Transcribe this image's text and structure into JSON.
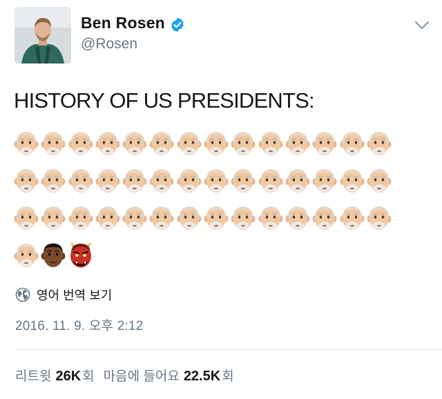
{
  "author": {
    "name": "Ben Rosen",
    "handle": "@Rosen",
    "verified": true
  },
  "tweet": {
    "text": "HISTORY OF US PRESIDENTS:",
    "emoji_rows": [
      [
        "older-man",
        "older-man",
        "older-man",
        "older-man",
        "older-man",
        "older-man",
        "older-man",
        "older-man",
        "older-man",
        "older-man",
        "older-man",
        "older-man",
        "older-man",
        "older-man"
      ],
      [
        "older-man",
        "older-man",
        "older-man",
        "older-man",
        "older-man",
        "older-man",
        "older-man",
        "older-man",
        "older-man",
        "older-man",
        "older-man",
        "older-man",
        "older-man",
        "older-man"
      ],
      [
        "older-man",
        "older-man",
        "older-man",
        "older-man",
        "older-man",
        "older-man",
        "older-man",
        "older-man",
        "older-man",
        "older-man",
        "older-man",
        "older-man",
        "older-man",
        "older-man"
      ],
      [
        "older-man",
        "man-dark-skin",
        "ogre"
      ]
    ],
    "translate_label": "영어 번역 보기",
    "timestamp": "2016. 11. 9. 오후 2:12"
  },
  "stats": {
    "retweets_label": "리트윗",
    "retweets_value": "26K",
    "retweets_suffix": "회",
    "likes_label": "마음에 들어요",
    "likes_value": "22.5K",
    "likes_suffix": "회"
  },
  "icons": {
    "verified": "verified-badge-icon",
    "globe": "globe-icon",
    "caret": "chevron-down-icon"
  },
  "colors": {
    "verified_blue": "#1da1f2",
    "secondary_text": "#657786",
    "primary_text": "#14171a"
  }
}
